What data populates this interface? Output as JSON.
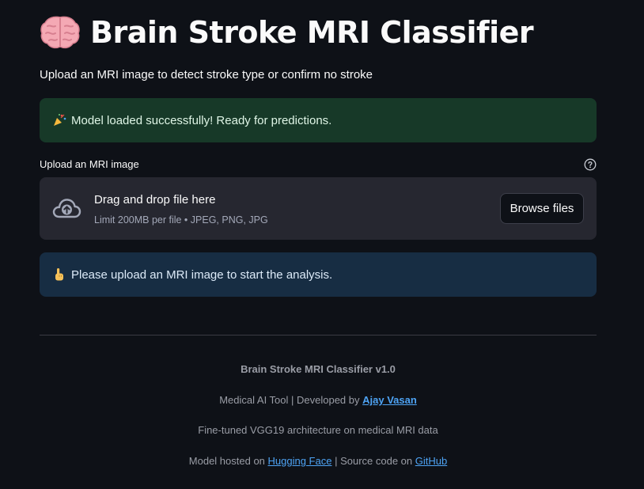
{
  "header": {
    "title_icon": "brain-emoji",
    "title": "Brain Stroke MRI Classifier",
    "subtitle": "Upload an MRI image to detect stroke type or confirm no stroke"
  },
  "success_alert": {
    "icon": "party-popper-emoji",
    "text": "Model loaded successfully! Ready for predictions."
  },
  "uploader": {
    "label": "Upload an MRI image",
    "help_icon": "question-circle-icon",
    "upload_icon": "cloud-upload-icon",
    "dropzone_title": "Drag and drop file here",
    "limit_text": "Limit 200MB per file • JPEG, PNG, JPG",
    "browse_label": "Browse files"
  },
  "info_alert": {
    "icon": "pointing-hand-emoji",
    "text": "Please upload an MRI image to start the analysis."
  },
  "footer": {
    "app_version": "Brain Stroke MRI Classifier v1.0",
    "developed_prefix": "Medical AI Tool | Developed by ",
    "developer_link": "Ajay Vasan",
    "architecture": "Fine-tuned VGG19 architecture on medical MRI data",
    "hosted_prefix": "Model hosted on ",
    "hf_link": "Hugging Face",
    "source_prefix": " | Source code on ",
    "github_link": "GitHub"
  },
  "colors": {
    "background": "#0e1117",
    "success_bg": "#173928",
    "info_bg": "#172d43",
    "dropzone_bg": "#262730",
    "link": "#4ea4f5"
  }
}
